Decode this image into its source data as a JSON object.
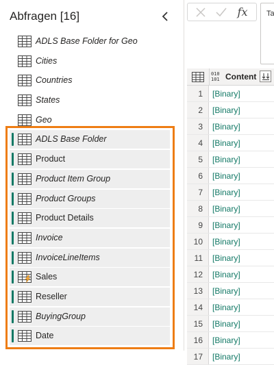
{
  "query_pane": {
    "title": "Abfragen [16]",
    "queries": [
      {
        "label": "ADLS Base Folder for Geo",
        "italic": true,
        "grouped": false,
        "icon": "table-icon"
      },
      {
        "label": "Cities",
        "italic": true,
        "grouped": false,
        "icon": "table-icon"
      },
      {
        "label": "Countries",
        "italic": true,
        "grouped": false,
        "icon": "table-icon"
      },
      {
        "label": "States",
        "italic": true,
        "grouped": false,
        "icon": "table-icon"
      },
      {
        "label": "Geo",
        "italic": true,
        "grouped": false,
        "icon": "table-icon"
      },
      {
        "label": "ADLS Base Folder",
        "italic": true,
        "grouped": true,
        "icon": "table-icon"
      },
      {
        "label": "Product",
        "italic": false,
        "grouped": true,
        "icon": "table-icon"
      },
      {
        "label": "Product Item Group",
        "italic": true,
        "grouped": true,
        "icon": "table-icon"
      },
      {
        "label": "Product Groups",
        "italic": true,
        "grouped": true,
        "icon": "table-icon"
      },
      {
        "label": "Product Details",
        "italic": false,
        "grouped": true,
        "icon": "table-icon"
      },
      {
        "label": "Invoice",
        "italic": true,
        "grouped": true,
        "icon": "table-icon"
      },
      {
        "label": "InvoiceLineItems",
        "italic": true,
        "grouped": true,
        "icon": "table-icon"
      },
      {
        "label": "Sales",
        "italic": false,
        "grouped": true,
        "icon": "table-lightning-icon"
      },
      {
        "label": "Reseller",
        "italic": false,
        "grouped": true,
        "icon": "table-icon"
      },
      {
        "label": "BuyingGroup",
        "italic": true,
        "grouped": true,
        "icon": "table-icon"
      },
      {
        "label": "Date",
        "italic": false,
        "grouped": true,
        "icon": "table-icon"
      }
    ]
  },
  "formula_bar": {
    "fx_label": "fx",
    "text": "Ta"
  },
  "grid": {
    "column_header": "Content",
    "column_type_label": "010\n101",
    "rows": [
      {
        "num": "1",
        "value": "[Binary]"
      },
      {
        "num": "2",
        "value": "[Binary]"
      },
      {
        "num": "3",
        "value": "[Binary]"
      },
      {
        "num": "4",
        "value": "[Binary]"
      },
      {
        "num": "5",
        "value": "[Binary]"
      },
      {
        "num": "6",
        "value": "[Binary]"
      },
      {
        "num": "7",
        "value": "[Binary]"
      },
      {
        "num": "8",
        "value": "[Binary]"
      },
      {
        "num": "9",
        "value": "[Binary]"
      },
      {
        "num": "10",
        "value": "[Binary]"
      },
      {
        "num": "11",
        "value": "[Binary]"
      },
      {
        "num": "12",
        "value": "[Binary]"
      },
      {
        "num": "13",
        "value": "[Binary]"
      },
      {
        "num": "14",
        "value": "[Binary]"
      },
      {
        "num": "15",
        "value": "[Binary]"
      },
      {
        "num": "16",
        "value": "[Binary]"
      },
      {
        "num": "17",
        "value": "[Binary]"
      }
    ]
  },
  "colors": {
    "group_bar": "#117865",
    "highlight": "#ee7d14",
    "binary_text": "#117865"
  }
}
